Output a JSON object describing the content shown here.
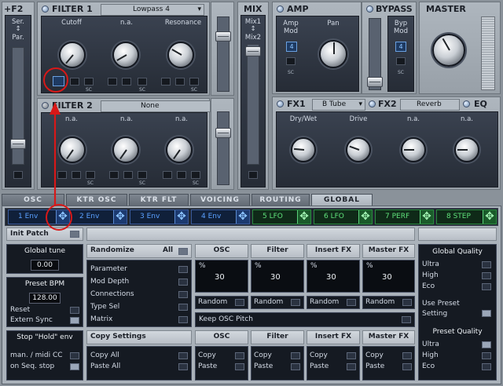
{
  "top": {
    "f2": {
      "title": "F2",
      "serial_top": "Ser.",
      "serial_bottom": "Par."
    },
    "filter1": {
      "title": "FILTER 1",
      "type": "Lowpass 4",
      "knobs": [
        "Cutoff",
        "n.a.",
        "Resonance"
      ],
      "sc": "SC"
    },
    "filter2": {
      "title": "FILTER 2",
      "type": "None",
      "knobs": [
        "n.a.",
        "n.a.",
        "n.a."
      ],
      "sc": "SC"
    },
    "mix": {
      "title": "MIX",
      "top": "Mix1",
      "bottom": "Mix2"
    },
    "amp": {
      "title": "AMP",
      "mod_top": "Amp",
      "mod_bottom": "Mod",
      "mod_value": "4",
      "pan": "Pan",
      "sc": "SC"
    },
    "bypass": {
      "title": "BYPASS",
      "mod_top": "Byp",
      "mod_bottom": "Mod",
      "mod_value": "4",
      "sc": "SC"
    },
    "master": {
      "title": "MASTER"
    },
    "fx1": {
      "title": "FX1",
      "type": "B Tube",
      "knobs": [
        "Dry/Wet",
        "Drive",
        "n.a.",
        "n.a."
      ]
    },
    "fx2": {
      "title": "FX2",
      "type": "Reverb"
    },
    "eq": {
      "title": "EQ"
    }
  },
  "tabs": [
    "OSC",
    "KTR OSC",
    "KTR FLT",
    "VOICING",
    "ROUTING",
    "GLOBAL"
  ],
  "mods": [
    "1 Env",
    "2 Env",
    "3 Env",
    "4 Env",
    "5 LFO",
    "6 LFO",
    "7 PERF",
    "8 STEP"
  ],
  "global": {
    "init_patch": "Init Patch",
    "global_tune": {
      "label": "Global tune",
      "value": "0.00"
    },
    "preset_bpm": {
      "label": "Preset BPM",
      "value": "128.00"
    },
    "reset": "Reset",
    "extern_sync": "Extern Sync",
    "stop_hold": "Stop \"Hold\" env",
    "man_midi": "man. / midi CC",
    "on_seq_stop": "on Seq. stop",
    "randomize": {
      "label": "Randomize",
      "all": "All",
      "items": [
        "Parameter",
        "Mod Depth",
        "Connections",
        "Type Sel",
        "Matrix"
      ]
    },
    "copy_settings": {
      "label": "Copy Settings",
      "items": [
        "Copy All",
        "Paste All"
      ]
    },
    "columns": [
      "OSC",
      "Filter",
      "Insert FX",
      "Master FX"
    ],
    "percent_sign": "%",
    "percents": [
      "30",
      "30",
      "30",
      "30"
    ],
    "random": "Random",
    "keep_osc_pitch": "Keep OSC Pitch",
    "copy": "Copy",
    "paste": "Paste",
    "global_quality": {
      "label": "Global Quality",
      "items": [
        "Ultra",
        "High",
        "Eco"
      ]
    },
    "use_preset_line1": "Use Preset",
    "use_preset_line2": "Setting",
    "preset_quality": {
      "label": "Preset Quality",
      "items": [
        "Ultra",
        "High",
        "Eco"
      ]
    }
  }
}
